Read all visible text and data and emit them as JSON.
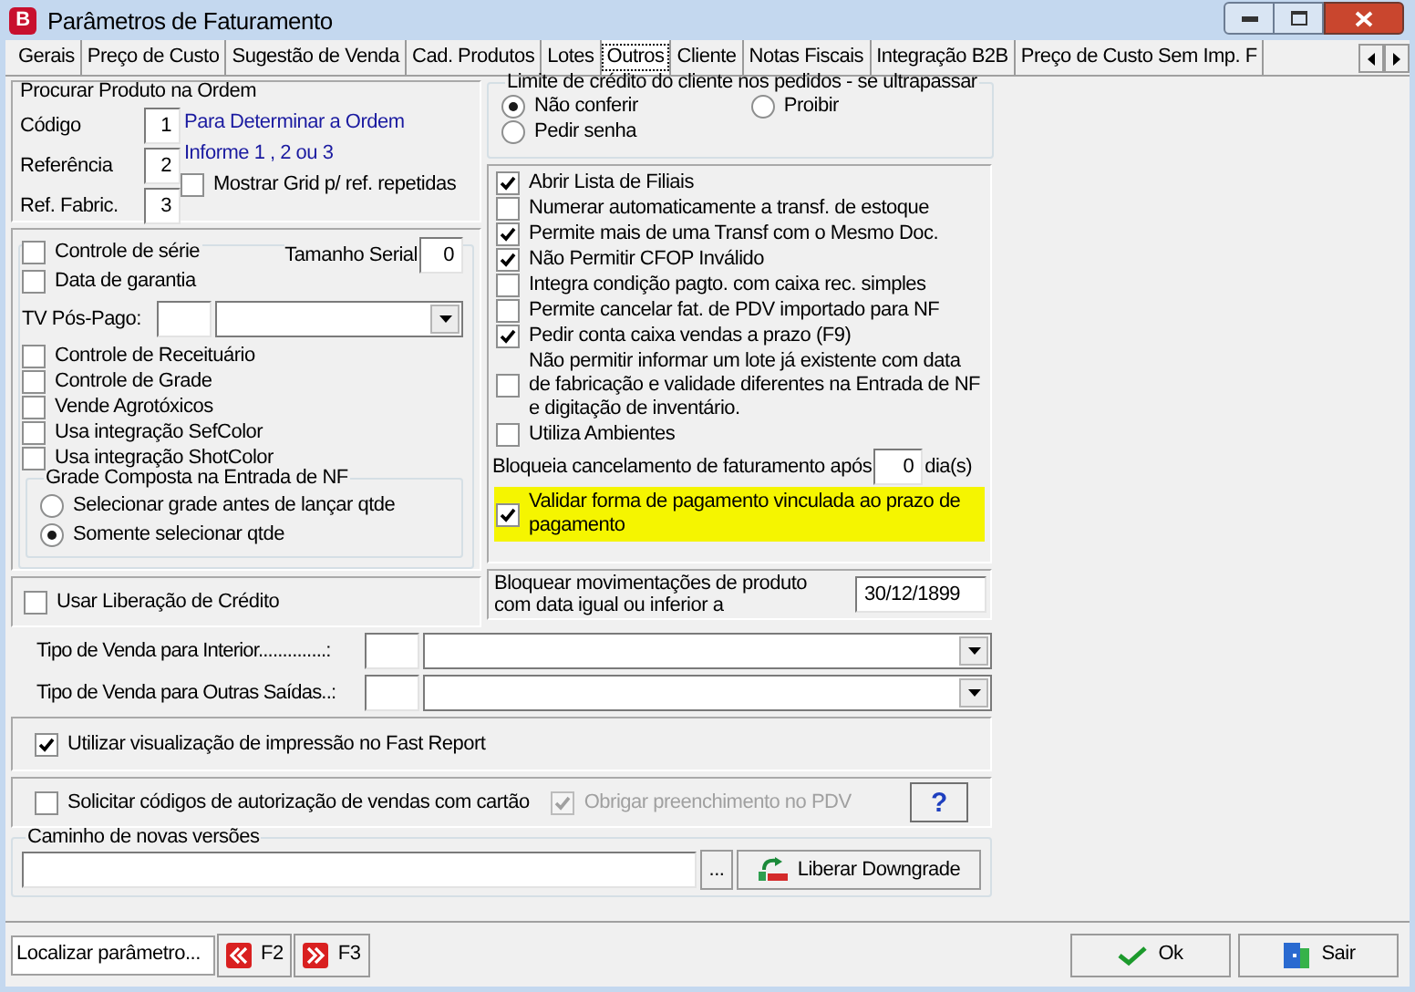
{
  "window": {
    "title": "Parâmetros de Faturamento",
    "logo": "B"
  },
  "tabs": [
    {
      "label": "Gerais",
      "selected": false
    },
    {
      "label": "Preço de Custo",
      "selected": false
    },
    {
      "label": "Sugestão de  Venda",
      "selected": false
    },
    {
      "label": "Cad. Produtos",
      "selected": false
    },
    {
      "label": "Lotes",
      "selected": false
    },
    {
      "label": "Outros",
      "selected": true
    },
    {
      "label": "Cliente",
      "selected": false
    },
    {
      "label": "Notas Fiscais",
      "selected": false
    },
    {
      "label": "Integração B2B",
      "selected": false
    },
    {
      "label": "Preço de Custo Sem Imp. F",
      "selected": false
    }
  ],
  "search_order": {
    "title": "Procurar Produto na Ordem",
    "fields": [
      {
        "label": "Código",
        "value": "1"
      },
      {
        "label": "Referência",
        "value": "2"
      },
      {
        "label": "Ref. Fabric.",
        "value": "3"
      }
    ],
    "hint_lines": [
      "Para Determinar a Ordem",
      "Informe 1 , 2 ou 3"
    ],
    "show_grid": {
      "label": "Mostrar Grid p/ ref. repetidas",
      "checked": false
    }
  },
  "serial": {
    "control": {
      "label": "Controle de série",
      "checked": false
    },
    "serial_size": {
      "label": "Tamanho Serial",
      "value": "0"
    },
    "warranty": {
      "label": "Data de garantia",
      "checked": false
    },
    "tv_pos_pago": {
      "label": "TV Pós-Pago:"
    },
    "options": [
      {
        "label": "Controle de Receituário",
        "checked": false
      },
      {
        "label": "Controle de Grade",
        "checked": false
      },
      {
        "label": "Vende Agrotóxicos",
        "checked": false
      },
      {
        "label": "Usa integração SefColor",
        "checked": false
      },
      {
        "label": "Usa integração ShotColor",
        "checked": false
      }
    ],
    "grade_group": {
      "title": "Grade Composta na Entrada de NF",
      "options": [
        {
          "label": "Selecionar grade antes de lançar qtde",
          "selected": false
        },
        {
          "label": "Somente selecionar qtde",
          "selected": true
        }
      ]
    }
  },
  "credit_release": {
    "label": "Usar Liberação de Crédito",
    "checked": false
  },
  "credit_limit": {
    "title": "Limite de crédito do cliente nos pedidos - se ultrapassar",
    "options": [
      {
        "label": "Não conferir",
        "selected": true
      },
      {
        "label": "Proibir",
        "selected": false
      },
      {
        "label": "Pedir senha",
        "selected": false
      }
    ]
  },
  "right_options": [
    {
      "kind": "checkbox",
      "label": "Abrir Lista de Filiais",
      "checked": true,
      "highlighted": false
    },
    {
      "kind": "checkbox",
      "label": "Numerar automaticamente a transf. de estoque",
      "checked": false,
      "highlighted": false
    },
    {
      "kind": "checkbox",
      "label": "Permite mais de uma Transf com o Mesmo Doc.",
      "checked": true,
      "highlighted": false
    },
    {
      "kind": "checkbox",
      "label": "Não Permitir CFOP Inválido",
      "checked": true,
      "highlighted": false
    },
    {
      "kind": "checkbox",
      "label": "Integra condição pagto. com caixa rec. simples",
      "checked": false,
      "highlighted": false
    },
    {
      "kind": "checkbox",
      "label": "Permite cancelar fat. de PDV importado para NF",
      "checked": false,
      "highlighted": false
    },
    {
      "kind": "checkbox",
      "label": "Pedir conta caixa vendas a prazo (F9)",
      "checked": true,
      "highlighted": false
    },
    {
      "kind": "checkbox",
      "label": "Não permitir informar um lote já existente com data de fabricação e validade diferentes na Entrada de NF e digitação de inventário.",
      "checked": false,
      "highlighted": false
    },
    {
      "kind": "checkbox",
      "label": "Utiliza Ambientes",
      "checked": false,
      "highlighted": false
    },
    {
      "kind": "days",
      "label": "Bloqueia cancelamento de faturamento após",
      "value": "0",
      "unit": "dia(s)"
    },
    {
      "kind": "checkbox",
      "label": "Validar forma de pagamento vinculada ao prazo de pagamento",
      "checked": true,
      "highlighted": true
    }
  ],
  "block_movements": {
    "label": "Bloquear movimentações de produto com data igual ou inferior a",
    "value": "30/12/1899"
  },
  "sale_types": [
    {
      "label": "Tipo de Venda para Interior..............:"
    },
    {
      "label": "Tipo de Venda para Outras Saídas..:"
    }
  ],
  "fast_report": {
    "label": "Utilizar visualização de impressão no Fast Report",
    "checked": true
  },
  "card_auth": {
    "label": "Solicitar códigos de autorização de vendas com cartão",
    "checked": false
  },
  "require_pdv": {
    "label": "Obrigar preenchimento no PDV",
    "checked": true,
    "disabled": true
  },
  "help_button": "?",
  "versions": {
    "title": "Caminho de novas versões",
    "browse": "...",
    "downgrade": "Liberar Downgrade"
  },
  "footer": {
    "search_value": "Localizar parâmetro...",
    "prev": "F2",
    "next": "F3",
    "ok": "Ok",
    "exit": "Sair"
  }
}
